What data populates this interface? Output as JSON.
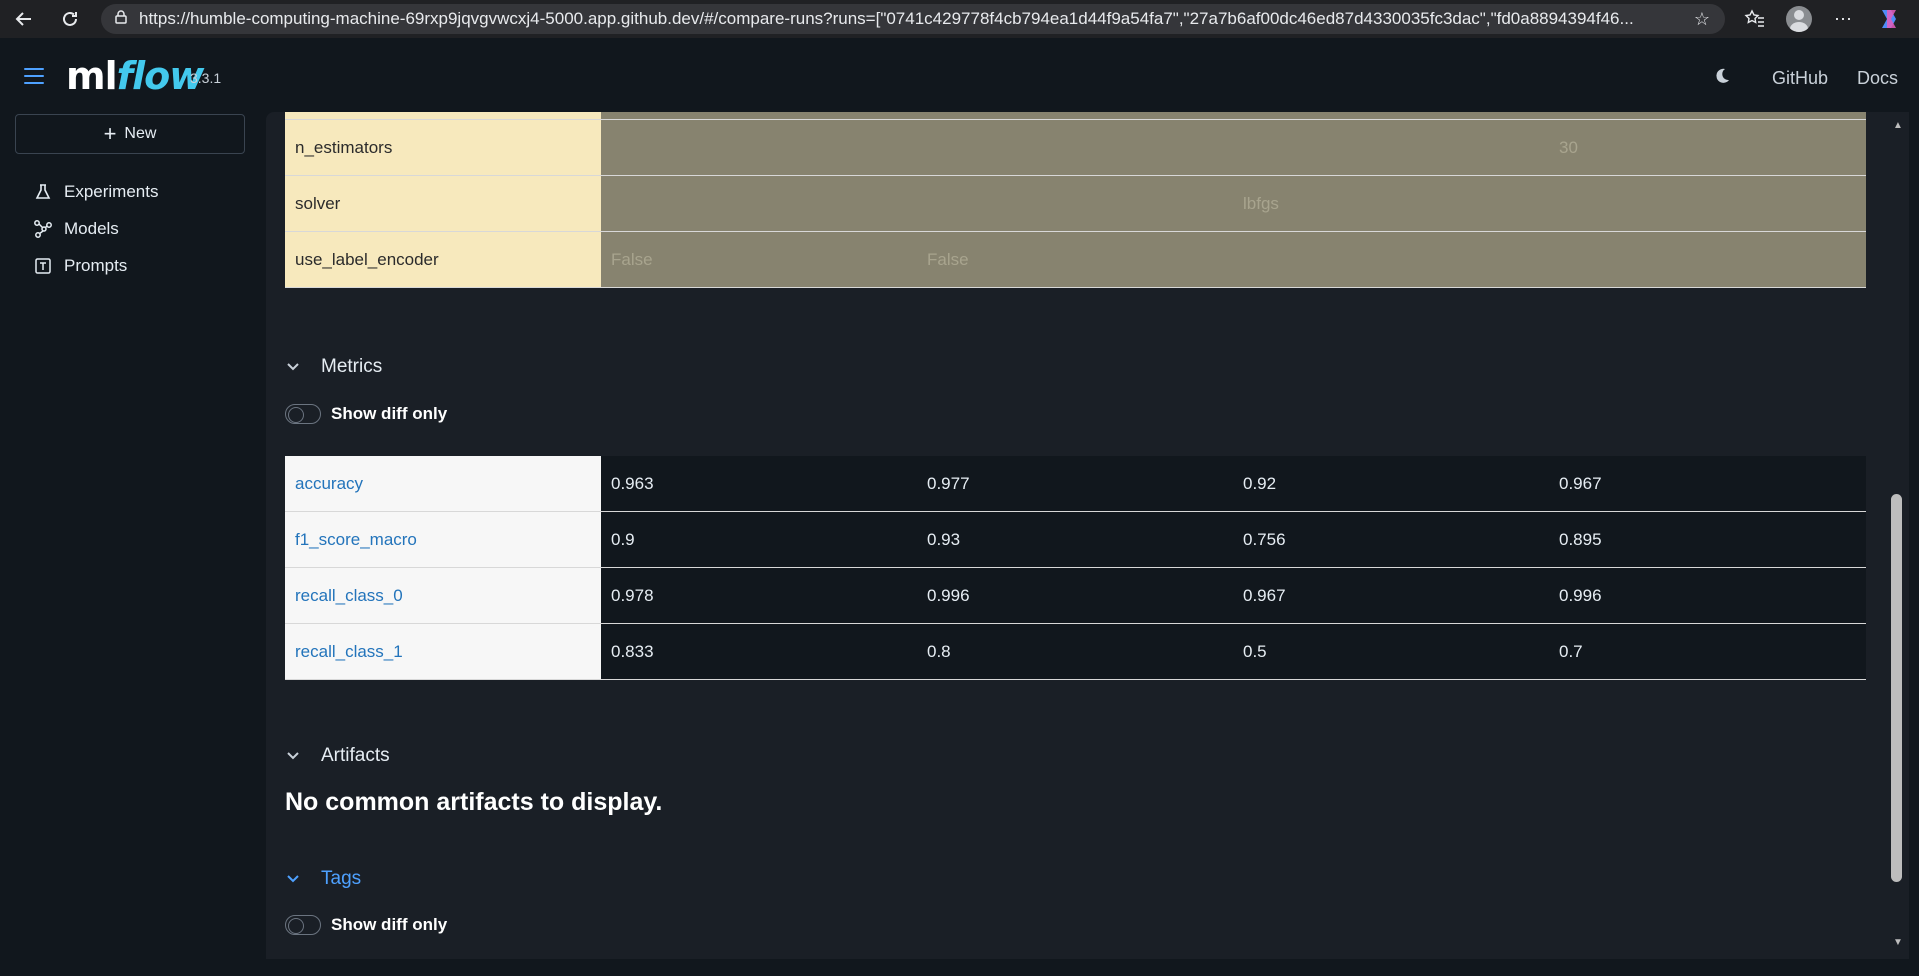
{
  "browser": {
    "url": "https://humble-computing-machine-69rxp9jqvgvwcxj4-5000.app.github.dev/#/compare-runs?runs=[\"0741c429778f4cb794ea1d44f9a54fa7\",\"27a7b6af00dc46ed87d4330035fc3dac\",\"fd0a8894394f46...",
    "back_icon": "back-arrow-icon",
    "reload_icon": "reload-icon"
  },
  "header": {
    "logo_ml": "ml",
    "logo_flow": "flow",
    "version": "3.3.1",
    "links": [
      "GitHub",
      "Docs"
    ]
  },
  "sidebar": {
    "new_label": "New",
    "items": [
      {
        "label": "Experiments",
        "icon": "beaker-icon"
      },
      {
        "label": "Models",
        "icon": "models-icon"
      },
      {
        "label": "Prompts",
        "icon": "prompts-icon"
      }
    ]
  },
  "params": {
    "rows": [
      {
        "key": "n_estimators",
        "values": [
          "",
          "",
          "",
          "30"
        ]
      },
      {
        "key": "solver",
        "values": [
          "",
          "",
          "lbfgs",
          ""
        ]
      },
      {
        "key": "use_label_encoder",
        "values": [
          "False",
          "False",
          "",
          ""
        ]
      }
    ]
  },
  "metrics": {
    "title": "Metrics",
    "toggle_label": "Show diff only",
    "rows": [
      {
        "key": "accuracy",
        "values": [
          "0.963",
          "0.977",
          "0.92",
          "0.967"
        ]
      },
      {
        "key": "f1_score_macro",
        "values": [
          "0.9",
          "0.93",
          "0.756",
          "0.895"
        ]
      },
      {
        "key": "recall_class_0",
        "values": [
          "0.978",
          "0.996",
          "0.967",
          "0.996"
        ]
      },
      {
        "key": "recall_class_1",
        "values": [
          "0.833",
          "0.8",
          "0.5",
          "0.7"
        ]
      }
    ]
  },
  "artifacts": {
    "title": "Artifacts",
    "empty_message": "No common artifacts to display."
  },
  "tags": {
    "title": "Tags",
    "toggle_label": "Show diff only"
  },
  "colors": {
    "accent": "#4ea1ff",
    "param_key_bg": "#f7e9bd",
    "param_val_bg": "#87836f",
    "metric_key_color": "#2374bb"
  }
}
